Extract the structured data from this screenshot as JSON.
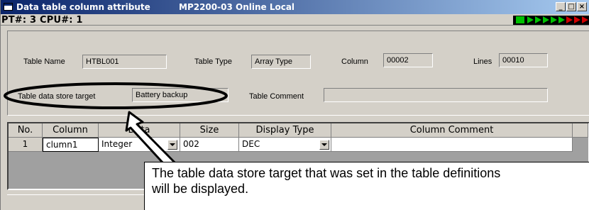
{
  "window": {
    "title": "Data table column attribute",
    "status": "MP2200-03 Online  Local",
    "minimize": "_",
    "maximize": "□",
    "close": "×"
  },
  "info": {
    "pt_cpu": "PT#: 3 CPU#: 1"
  },
  "form": {
    "table_name_label": "Table Name",
    "table_name_value": "HTBL001",
    "table_type_label": "Table Type",
    "table_type_value": "Array Type",
    "column_label": "Column",
    "column_value": "00002",
    "lines_label": "Lines",
    "lines_value": "00010",
    "store_target_label": "Table data store target",
    "store_target_value": "Battery backup",
    "table_comment_label": "Table Comment",
    "table_comment_value": ""
  },
  "grid": {
    "headers": [
      "No.",
      "Column",
      "Data",
      "Size",
      "Display Type",
      "Column Comment"
    ],
    "rows": [
      {
        "no": "1",
        "column": "clumn1",
        "data": "Integer",
        "size": "002",
        "display_type": "DEC",
        "comment": ""
      }
    ]
  },
  "callout": {
    "line1": "The table data store target that was set in the table definitions",
    "line2": "will be displayed."
  },
  "colors": {
    "titlebar_start": "#0a246a",
    "titlebar_end": "#a6caf0",
    "indicator_green": "#00c000",
    "indicator_red": "#d00000"
  }
}
